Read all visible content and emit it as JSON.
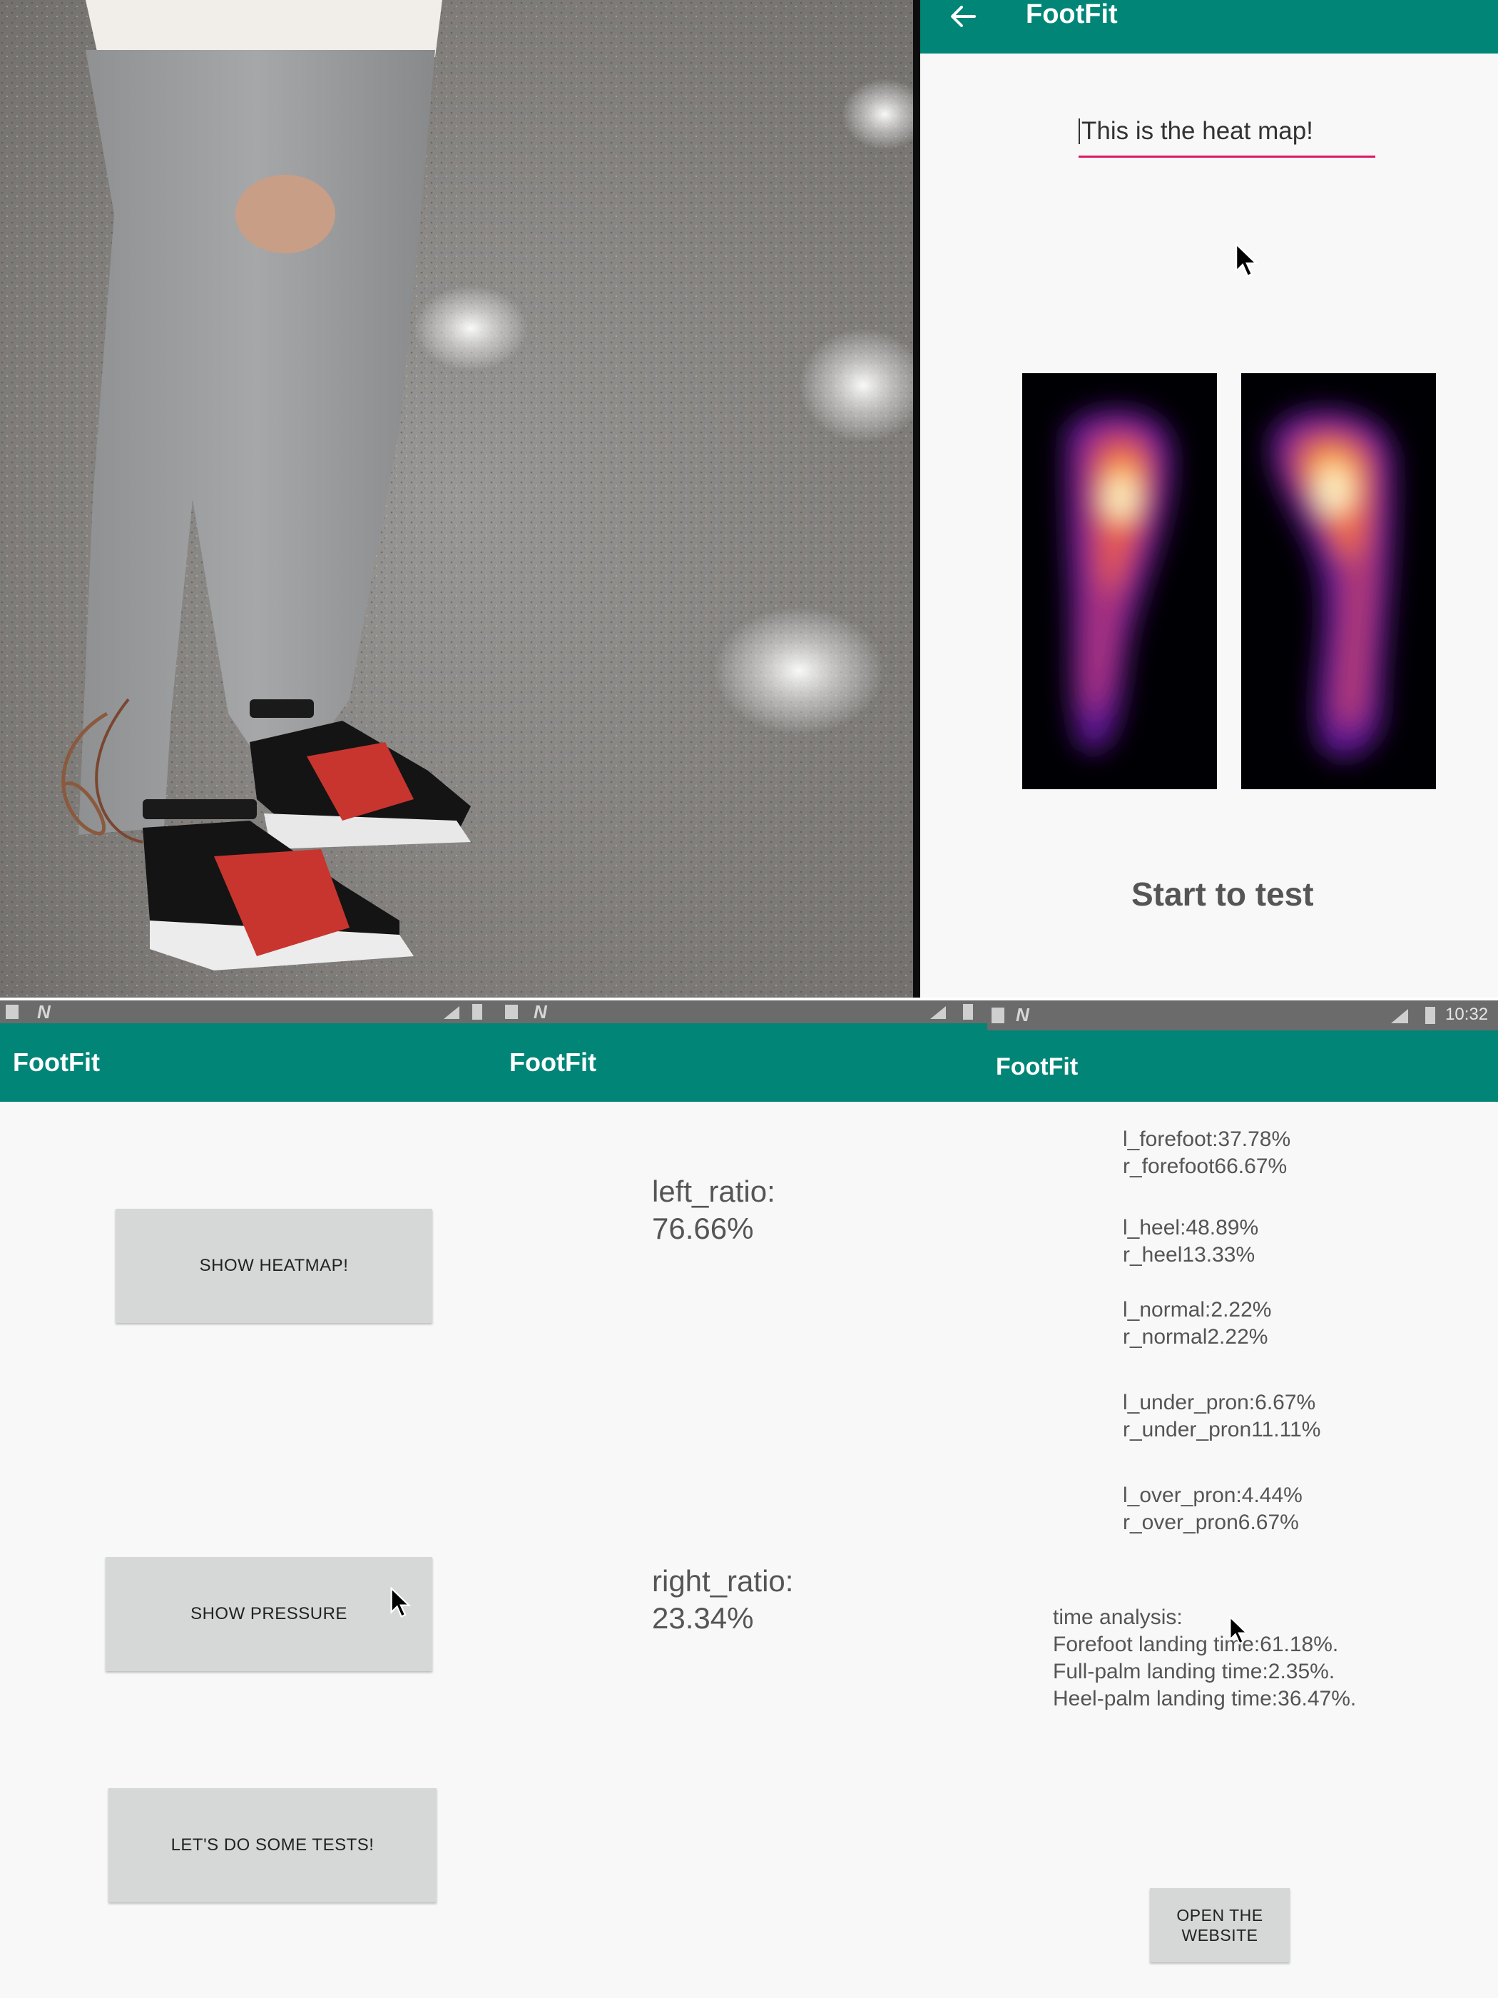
{
  "app": {
    "name": "FootFit"
  },
  "heatmap_screen": {
    "text_field_value": "This is the heat map!",
    "start_label": "Start to test"
  },
  "menu_screen": {
    "buttons": [
      "SHOW HEATMAP!",
      "SHOW PRESSURE",
      "LET'S DO SOME TESTS!"
    ]
  },
  "pressure_screen": {
    "left_label": "left_ratio:",
    "left_value": "76.66%",
    "right_label": "right_ratio:",
    "right_value": "23.34%"
  },
  "stats_screen": {
    "status_time": "10:32",
    "stats": [
      {
        "l": "l_forefoot:37.78%",
        "r": "r_forefoot66.67%"
      },
      {
        "l": "l_heel:48.89%",
        "r": "r_heel13.33%"
      },
      {
        "l": "l_normal:2.22%",
        "r": "r_normal2.22%"
      },
      {
        "l": "l_under_pron:6.67%",
        "r": "r_under_pron11.11%"
      },
      {
        "l": "l_over_pron:4.44%",
        "r": "r_over_pron6.67%"
      }
    ],
    "time_analysis": [
      "time analysis:",
      "Forefoot landing time:61.18%.",
      "Full-palm landing time:2.35%.",
      "Heel-palm landing time:36.47%."
    ],
    "website_button_line1": "OPEN THE",
    "website_button_line2": "WEBSITE"
  },
  "colors": {
    "appbar": "#008577",
    "accent": "#d81b60",
    "button": "#d6d7d7"
  }
}
